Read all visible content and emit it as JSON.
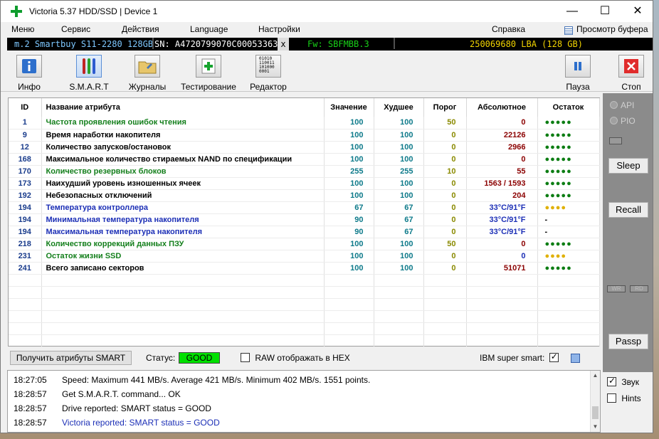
{
  "window": {
    "title": "Victoria 5.37 HDD/SSD | Device 1",
    "controls": {
      "minimize": "—",
      "maximize": "☐",
      "close": "✕"
    }
  },
  "menu": {
    "items": [
      "Меню",
      "Сервис",
      "Действия",
      "Language",
      "Настройки"
    ],
    "help": "Справка",
    "buffer": "Просмотр буфера"
  },
  "device": {
    "model": "m.2 Smartbuy S11-2280 128GB",
    "serial": "SN: A4720799070C00053363",
    "close": "x",
    "firmware": "Fw: SBFMBB.3",
    "capacity": "250069680 LBA (128 GB)"
  },
  "toolbar": {
    "info": "Инфо",
    "smart": "S.M.A.R.T",
    "logs": "Журналы",
    "test": "Тестирование",
    "editor": "Редактор",
    "pause": "Пауза",
    "stop": "Стоп",
    "editor_glyph": "01010\n110011\n101000\n0001"
  },
  "table": {
    "headers": {
      "id": "ID",
      "name": "Название атрибута",
      "value": "Значение",
      "worst": "Худшее",
      "threshold": "Порог",
      "absolute": "Абсолютное",
      "remain": "Остаток"
    },
    "rows": [
      {
        "id": "1",
        "name": "Частота проявления ошибок чтения",
        "value": "100",
        "worst": "100",
        "thr": "50",
        "abs": "0",
        "rem": "●●●●●",
        "nameColor": "green",
        "thrColor": "olive",
        "absColor": "red",
        "dotColor": "green"
      },
      {
        "id": "9",
        "name": "Время наработки накопителя",
        "value": "100",
        "worst": "100",
        "thr": "0",
        "abs": "22126",
        "rem": "●●●●●",
        "nameColor": "black",
        "thrColor": "olive",
        "absColor": "red",
        "dotColor": "green"
      },
      {
        "id": "12",
        "name": "Количество запусков/остановок",
        "value": "100",
        "worst": "100",
        "thr": "0",
        "abs": "2966",
        "rem": "●●●●●",
        "nameColor": "black",
        "thrColor": "olive",
        "absColor": "red",
        "dotColor": "green"
      },
      {
        "id": "168",
        "name": "Максимальное количество стираемых NAND по спецификации",
        "value": "100",
        "worst": "100",
        "thr": "0",
        "abs": "0",
        "rem": "●●●●●",
        "nameColor": "black",
        "thrColor": "olive",
        "absColor": "red",
        "dotColor": "green"
      },
      {
        "id": "170",
        "name": "Количество резервных блоков",
        "value": "255",
        "worst": "255",
        "thr": "10",
        "abs": "55",
        "rem": "●●●●●",
        "nameColor": "green",
        "thrColor": "olive",
        "absColor": "red",
        "dotColor": "green"
      },
      {
        "id": "173",
        "name": "Наихудший уровень изношенных ячеек",
        "value": "100",
        "worst": "100",
        "thr": "0",
        "abs": "1563 / 1593",
        "rem": "●●●●●",
        "nameColor": "black",
        "thrColor": "olive",
        "absColor": "red",
        "dotColor": "green"
      },
      {
        "id": "192",
        "name": "Небезопасных отключений",
        "value": "100",
        "worst": "100",
        "thr": "0",
        "abs": "204",
        "rem": "●●●●●",
        "nameColor": "black",
        "thrColor": "olive",
        "absColor": "red",
        "dotColor": "green"
      },
      {
        "id": "194",
        "name": "Температура контроллера",
        "value": "67",
        "worst": "67",
        "thr": "0",
        "abs": "33°C/91°F",
        "rem": "●●●●",
        "nameColor": "blue",
        "thrColor": "olive",
        "absColor": "blue",
        "dotColor": "yellow"
      },
      {
        "id": "194",
        "name": "Минимальная температура накопителя",
        "value": "90",
        "worst": "67",
        "thr": "0",
        "abs": "33°C/91°F",
        "rem": "-",
        "nameColor": "blue",
        "thrColor": "olive",
        "absColor": "blue",
        "dotColor": "black"
      },
      {
        "id": "194",
        "name": "Максимальная температура накопителя",
        "value": "90",
        "worst": "67",
        "thr": "0",
        "abs": "33°C/91°F",
        "rem": "-",
        "nameColor": "blue",
        "thrColor": "olive",
        "absColor": "blue",
        "dotColor": "black"
      },
      {
        "id": "218",
        "name": "Количество коррекций данных ПЗУ",
        "value": "100",
        "worst": "100",
        "thr": "50",
        "abs": "0",
        "rem": "●●●●●",
        "nameColor": "green",
        "thrColor": "olive",
        "absColor": "red",
        "dotColor": "green"
      },
      {
        "id": "231",
        "name": "Остаток жизни SSD",
        "value": "100",
        "worst": "100",
        "thr": "0",
        "abs": "0",
        "rem": "●●●●",
        "nameColor": "green",
        "thrColor": "olive",
        "absColor": "blue",
        "dotColor": "yellow"
      },
      {
        "id": "241",
        "name": "Всего записано секторов",
        "value": "100",
        "worst": "100",
        "thr": "0",
        "abs": "51071",
        "rem": "●●●●●",
        "nameColor": "black",
        "thrColor": "olive",
        "absColor": "red",
        "dotColor": "green"
      }
    ],
    "empty_rows": 6
  },
  "right_panel": {
    "api": "API",
    "pio": "PIO",
    "sleep": "Sleep",
    "recall": "Recall",
    "passp": "Passp",
    "wr": "WR",
    "rd": "RD"
  },
  "bottom": {
    "get_attrs": "Получить атрибуты SMART",
    "status_label": "Статус:",
    "status_value": "GOOD",
    "raw_hex": "RAW отображать в HEX",
    "raw_hex_checked": false,
    "ibm_label": "IBM super smart:",
    "ibm_checked": true
  },
  "log": [
    {
      "time": "18:27:05",
      "msg": "Speed: Maximum 441 MB/s. Average 421 MB/s. Minimum 402 MB/s. 1551 points.",
      "color": "#000000"
    },
    {
      "time": "18:28:57",
      "msg": "Get S.M.A.R.T. command... OK",
      "color": "#000000"
    },
    {
      "time": "18:28:57",
      "msg": "Drive reported: SMART status = GOOD",
      "color": "#000000"
    },
    {
      "time": "18:28:57",
      "msg": "Victoria reported: SMART status = GOOD",
      "color": "#1c2fb6"
    }
  ],
  "options": {
    "sound": "Звук",
    "sound_checked": true,
    "hints": "Hints",
    "hints_checked": false
  },
  "colors": {
    "green_dot": "#0c7d13",
    "yellow_dot": "#e0b000",
    "status_good": "#00e000",
    "info_model": "#7ec8ff",
    "info_fw": "#18d018",
    "info_cap": "#f2d400"
  }
}
